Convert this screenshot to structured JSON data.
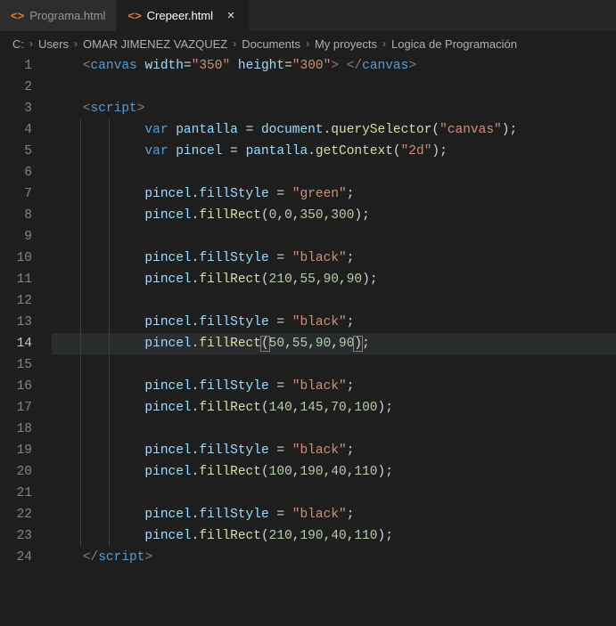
{
  "tabs": [
    {
      "icon": "<>",
      "label": "Programa.html",
      "active": false
    },
    {
      "icon": "<>",
      "label": "Crepeer.html",
      "active": true
    }
  ],
  "close_glyph": "×",
  "breadcrumbs": [
    "C:",
    "Users",
    "OMAR JIMENEZ VAZQUEZ",
    "Documents",
    "My proyects",
    "Logica de Programación"
  ],
  "chevron": "›",
  "active_line": 14,
  "code_lines": [
    {
      "n": 1,
      "ind": 0,
      "seg": [
        [
          "punc",
          "<"
        ],
        [
          "tag",
          "canvas"
        ],
        [
          "txt",
          " "
        ],
        [
          "attr",
          "width"
        ],
        [
          "op",
          "="
        ],
        [
          "str",
          "\"350\""
        ],
        [
          "txt",
          " "
        ],
        [
          "attr",
          "height"
        ],
        [
          "op",
          "="
        ],
        [
          "str",
          "\"300\""
        ],
        [
          "punc",
          ">"
        ],
        [
          "txt",
          " "
        ],
        [
          "punc",
          "</"
        ],
        [
          "tag",
          "canvas"
        ],
        [
          "punc",
          ">"
        ]
      ]
    },
    {
      "n": 2,
      "ind": 0,
      "seg": []
    },
    {
      "n": 3,
      "ind": 0,
      "seg": [
        [
          "punc",
          "<"
        ],
        [
          "tag",
          "script"
        ],
        [
          "punc",
          ">"
        ]
      ]
    },
    {
      "n": 4,
      "ind": 2,
      "seg": [
        [
          "kw",
          "var"
        ],
        [
          "txt",
          " "
        ],
        [
          "var",
          "pantalla"
        ],
        [
          "txt",
          " "
        ],
        [
          "op",
          "="
        ],
        [
          "txt",
          " "
        ],
        [
          "var",
          "document"
        ],
        [
          "op",
          "."
        ],
        [
          "func",
          "querySelector"
        ],
        [
          "op",
          "("
        ],
        [
          "str",
          "\"canvas\""
        ],
        [
          "op",
          ")"
        ],
        [
          "op",
          ";"
        ]
      ]
    },
    {
      "n": 5,
      "ind": 2,
      "seg": [
        [
          "kw",
          "var"
        ],
        [
          "txt",
          " "
        ],
        [
          "var",
          "pincel"
        ],
        [
          "txt",
          " "
        ],
        [
          "op",
          "="
        ],
        [
          "txt",
          " "
        ],
        [
          "var",
          "pantalla"
        ],
        [
          "op",
          "."
        ],
        [
          "func",
          "getContext"
        ],
        [
          "op",
          "("
        ],
        [
          "str",
          "\"2d\""
        ],
        [
          "op",
          ")"
        ],
        [
          "op",
          ";"
        ]
      ]
    },
    {
      "n": 6,
      "ind": 2,
      "seg": []
    },
    {
      "n": 7,
      "ind": 2,
      "seg": [
        [
          "var",
          "pincel"
        ],
        [
          "op",
          "."
        ],
        [
          "var",
          "fillStyle"
        ],
        [
          "txt",
          " "
        ],
        [
          "op",
          "="
        ],
        [
          "txt",
          " "
        ],
        [
          "str",
          "\"green\""
        ],
        [
          "op",
          ";"
        ]
      ]
    },
    {
      "n": 8,
      "ind": 2,
      "seg": [
        [
          "var",
          "pincel"
        ],
        [
          "op",
          "."
        ],
        [
          "func",
          "fillRect"
        ],
        [
          "op",
          "("
        ],
        [
          "num",
          "0"
        ],
        [
          "op",
          ","
        ],
        [
          "num",
          "0"
        ],
        [
          "op",
          ","
        ],
        [
          "num",
          "350"
        ],
        [
          "op",
          ","
        ],
        [
          "num",
          "300"
        ],
        [
          "op",
          ")"
        ],
        [
          "op",
          ";"
        ]
      ]
    },
    {
      "n": 9,
      "ind": 2,
      "seg": []
    },
    {
      "n": 10,
      "ind": 2,
      "seg": [
        [
          "var",
          "pincel"
        ],
        [
          "op",
          "."
        ],
        [
          "var",
          "fillStyle"
        ],
        [
          "txt",
          " "
        ],
        [
          "op",
          "="
        ],
        [
          "txt",
          " "
        ],
        [
          "str",
          "\"black\""
        ],
        [
          "op",
          ";"
        ]
      ]
    },
    {
      "n": 11,
      "ind": 2,
      "seg": [
        [
          "var",
          "pincel"
        ],
        [
          "op",
          "."
        ],
        [
          "func",
          "fillRect"
        ],
        [
          "op",
          "("
        ],
        [
          "num",
          "210"
        ],
        [
          "op",
          ","
        ],
        [
          "num",
          "55"
        ],
        [
          "op",
          ","
        ],
        [
          "num",
          "90"
        ],
        [
          "op",
          ","
        ],
        [
          "num",
          "90"
        ],
        [
          "op",
          ")"
        ],
        [
          "op",
          ";"
        ]
      ]
    },
    {
      "n": 12,
      "ind": 2,
      "seg": []
    },
    {
      "n": 13,
      "ind": 2,
      "seg": [
        [
          "var",
          "pincel"
        ],
        [
          "op",
          "."
        ],
        [
          "var",
          "fillStyle"
        ],
        [
          "txt",
          " "
        ],
        [
          "op",
          "="
        ],
        [
          "txt",
          " "
        ],
        [
          "str",
          "\"black\""
        ],
        [
          "op",
          ";"
        ]
      ]
    },
    {
      "n": 14,
      "ind": 2,
      "hl": true,
      "seg": [
        [
          "var",
          "pincel"
        ],
        [
          "op",
          "."
        ],
        [
          "func",
          "fillRect"
        ],
        [
          "bhl",
          "("
        ],
        [
          "num",
          "50"
        ],
        [
          "op",
          ","
        ],
        [
          "num",
          "55"
        ],
        [
          "op",
          ","
        ],
        [
          "num",
          "90"
        ],
        [
          "op",
          ","
        ],
        [
          "num",
          "90"
        ],
        [
          "bhl",
          ")"
        ],
        [
          "op",
          ";"
        ]
      ]
    },
    {
      "n": 15,
      "ind": 2,
      "seg": []
    },
    {
      "n": 16,
      "ind": 2,
      "seg": [
        [
          "var",
          "pincel"
        ],
        [
          "op",
          "."
        ],
        [
          "var",
          "fillStyle"
        ],
        [
          "txt",
          " "
        ],
        [
          "op",
          "="
        ],
        [
          "txt",
          " "
        ],
        [
          "str",
          "\"black\""
        ],
        [
          "op",
          ";"
        ]
      ]
    },
    {
      "n": 17,
      "ind": 2,
      "seg": [
        [
          "var",
          "pincel"
        ],
        [
          "op",
          "."
        ],
        [
          "func",
          "fillRect"
        ],
        [
          "op",
          "("
        ],
        [
          "num",
          "140"
        ],
        [
          "op",
          ","
        ],
        [
          "num",
          "145"
        ],
        [
          "op",
          ","
        ],
        [
          "num",
          "70"
        ],
        [
          "op",
          ","
        ],
        [
          "num",
          "100"
        ],
        [
          "op",
          ")"
        ],
        [
          "op",
          ";"
        ]
      ]
    },
    {
      "n": 18,
      "ind": 2,
      "seg": []
    },
    {
      "n": 19,
      "ind": 2,
      "seg": [
        [
          "var",
          "pincel"
        ],
        [
          "op",
          "."
        ],
        [
          "var",
          "fillStyle"
        ],
        [
          "txt",
          " "
        ],
        [
          "op",
          "="
        ],
        [
          "txt",
          " "
        ],
        [
          "str",
          "\"black\""
        ],
        [
          "op",
          ";"
        ]
      ]
    },
    {
      "n": 20,
      "ind": 2,
      "seg": [
        [
          "var",
          "pincel"
        ],
        [
          "op",
          "."
        ],
        [
          "func",
          "fillRect"
        ],
        [
          "op",
          "("
        ],
        [
          "num",
          "100"
        ],
        [
          "op",
          ","
        ],
        [
          "num",
          "190"
        ],
        [
          "op",
          ","
        ],
        [
          "num",
          "40"
        ],
        [
          "op",
          ","
        ],
        [
          "num",
          "110"
        ],
        [
          "op",
          ")"
        ],
        [
          "op",
          ";"
        ]
      ]
    },
    {
      "n": 21,
      "ind": 2,
      "seg": []
    },
    {
      "n": 22,
      "ind": 2,
      "seg": [
        [
          "var",
          "pincel"
        ],
        [
          "op",
          "."
        ],
        [
          "var",
          "fillStyle"
        ],
        [
          "txt",
          " "
        ],
        [
          "op",
          "="
        ],
        [
          "txt",
          " "
        ],
        [
          "str",
          "\"black\""
        ],
        [
          "op",
          ";"
        ]
      ]
    },
    {
      "n": 23,
      "ind": 2,
      "seg": [
        [
          "var",
          "pincel"
        ],
        [
          "op",
          "."
        ],
        [
          "func",
          "fillRect"
        ],
        [
          "op",
          "("
        ],
        [
          "num",
          "210"
        ],
        [
          "op",
          ","
        ],
        [
          "num",
          "190"
        ],
        [
          "op",
          ","
        ],
        [
          "num",
          "40"
        ],
        [
          "op",
          ","
        ],
        [
          "num",
          "110"
        ],
        [
          "op",
          ")"
        ],
        [
          "op",
          ";"
        ]
      ]
    },
    {
      "n": 24,
      "ind": 0,
      "seg": [
        [
          "punc",
          "</"
        ],
        [
          "tag",
          "script"
        ],
        [
          "punc",
          ">"
        ]
      ]
    }
  ]
}
